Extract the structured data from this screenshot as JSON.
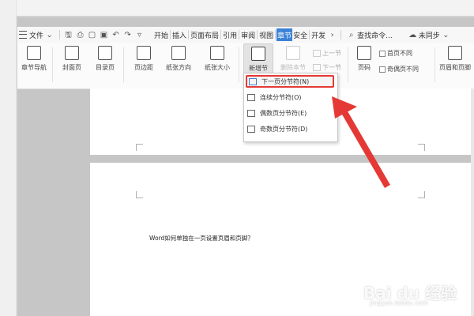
{
  "menubar": {
    "file_label": "文件",
    "tabs": [
      {
        "label": "开始",
        "active": false
      },
      {
        "label": "插入",
        "active": false
      },
      {
        "label": "页面布局",
        "active": false
      },
      {
        "label": "引用",
        "active": false
      },
      {
        "label": "审阅",
        "active": false
      },
      {
        "label": "视图",
        "active": false
      },
      {
        "label": "章节",
        "active": true
      },
      {
        "label": "安全",
        "active": false
      },
      {
        "label": "开发",
        "active": false
      }
    ],
    "search_label": "查找命令...",
    "sync_label": "未同步"
  },
  "ribbon": {
    "chapter_nav": "章节导航",
    "cover_page": "封面页",
    "toc_page": "目录页",
    "margins": "页边距",
    "orientation": "纸张方向",
    "paper_size": "纸张大小",
    "new_section": "新增节",
    "delete_section": "删除本节",
    "prev_section": "上一节",
    "next_section": "下一节",
    "page_number": "页码",
    "first_page_diff": "首页不同",
    "odd_even_diff": "奇偶页不同",
    "header_footer": "页眉和页脚"
  },
  "dropdown": {
    "items": [
      {
        "label": "下一页分节符(N)",
        "highlighted": true
      },
      {
        "label": "连续分节符(O)",
        "highlighted": false
      },
      {
        "label": "偶数页分节符(E)",
        "highlighted": false
      },
      {
        "label": "奇数页分节符(D)",
        "highlighted": false
      }
    ]
  },
  "document": {
    "body_text": "Word如何单独在一页设置页眉和页脚？"
  },
  "watermark": {
    "main": "Bai du 经验",
    "sub": "jingyan.baidu.com"
  },
  "colors": {
    "accent": "#3b82d6",
    "highlight": "#e53935"
  }
}
